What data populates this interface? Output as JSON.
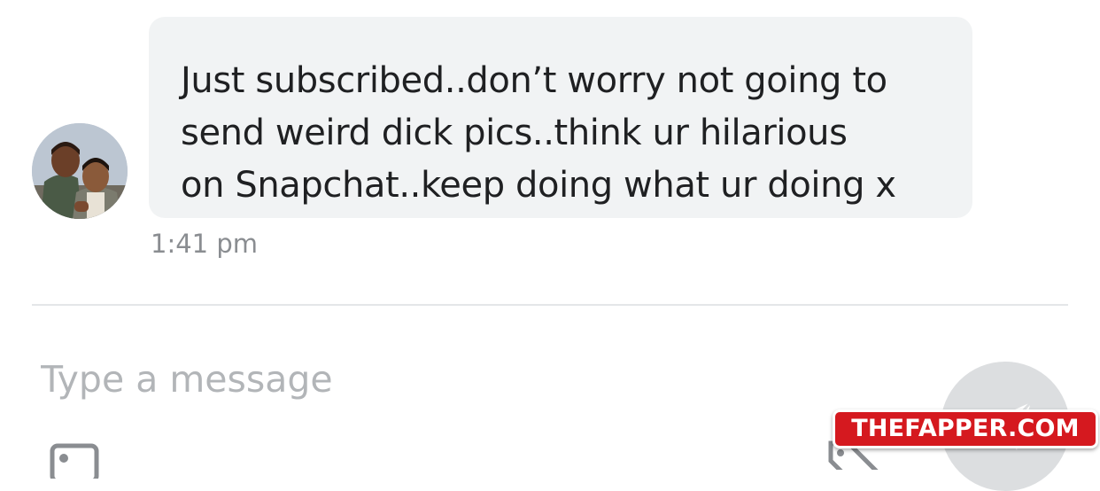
{
  "conversation": {
    "message": {
      "text": "Just subscribed..don’t worry not going to\nsend weird dick pics..think ur hilarious\non Snapchat..keep doing what ur doing x",
      "time": "1:41 pm"
    }
  },
  "composer": {
    "placeholder": "Type a message",
    "icons": [
      "image-icon",
      "send-icon",
      "price-tag-icon"
    ]
  },
  "watermark": {
    "text": "THEFAPPER.COM"
  },
  "colors": {
    "bubble": "#f1f3f4",
    "text": "#1f2022",
    "timestamp": "#8a8d91",
    "placeholder": "#b2b5b8",
    "divider": "#e4e6e8",
    "send_button": "#dcdee0",
    "watermark": "#d5191f"
  }
}
